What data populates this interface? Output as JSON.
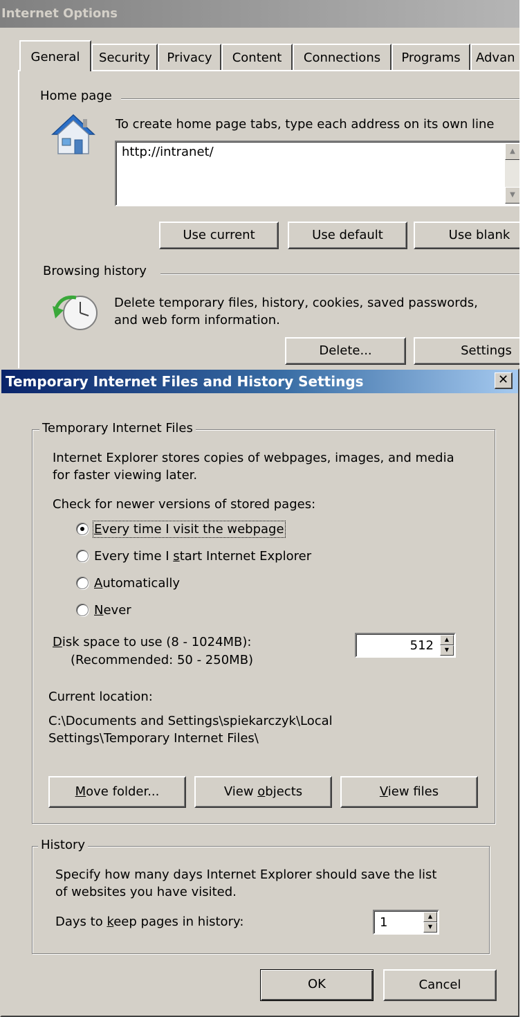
{
  "internet_options": {
    "title": "Internet Options",
    "tabs": [
      "General",
      "Security",
      "Privacy",
      "Content",
      "Connections",
      "Programs",
      "Advan"
    ],
    "active_tab": "General",
    "home_page": {
      "group_label": "Home page",
      "instruction": "To create home page tabs, type each address on its own line",
      "address_value": "http://intranet/",
      "buttons": {
        "use_current": "Use current",
        "use_default": "Use default",
        "use_blank": "Use blank"
      }
    },
    "browsing_history": {
      "group_label": "Browsing history",
      "description_line1": "Delete temporary files, history, cookies, saved passwords,",
      "description_line2": "and web form information.",
      "buttons": {
        "delete": "Delete...",
        "settings": "Settings"
      }
    }
  },
  "tif_dialog": {
    "title": "Temporary Internet Files and History Settings",
    "close_glyph": "✕",
    "temp_files": {
      "group_label": "Temporary Internet Files",
      "description_line1": "Internet Explorer stores copies of webpages, images, and media",
      "description_line2": "for faster viewing later.",
      "check_label": "Check for newer versions of stored pages:",
      "options": [
        {
          "label": "Every time I visit the webpage",
          "mnemonic": "E",
          "rest": "very time I visit the webpage",
          "checked": true
        },
        {
          "label": "Every time I start Internet Explorer",
          "before": "Every time I ",
          "mnemonic": "s",
          "rest": "tart Internet Explorer",
          "checked": false
        },
        {
          "label": "Automatically",
          "mnemonic": "A",
          "rest": "utomatically",
          "checked": false
        },
        {
          "label": "Never",
          "mnemonic": "N",
          "rest": "ever",
          "checked": false
        }
      ],
      "disk_space_mnemonic": "D",
      "disk_space_rest": "isk space to use (8 - 1024MB):",
      "disk_space_recommended": "(Recommended: 50 - 250MB)",
      "disk_space_value": "512",
      "current_location_label": "Current location:",
      "location_line1": "C:\\Documents and Settings\\spiekarczyk\\Local",
      "location_line2": "Settings\\Temporary Internet Files\\",
      "buttons": {
        "move_folder_mnemonic": "M",
        "move_folder_rest": "ove folder...",
        "view_objects_before": "View ",
        "view_objects_mnemonic": "o",
        "view_objects_rest": "bjects",
        "view_files_mnemonic": "V",
        "view_files_rest": "iew files"
      }
    },
    "history": {
      "group_label": "History",
      "description_line1": "Specify how many days Internet Explorer should save the list",
      "description_line2": "of websites you have visited.",
      "days_before": "Days to ",
      "days_mnemonic": "k",
      "days_rest": "eep pages in history:",
      "days_value": "1"
    },
    "footer": {
      "ok": "OK",
      "cancel": "Cancel"
    }
  }
}
